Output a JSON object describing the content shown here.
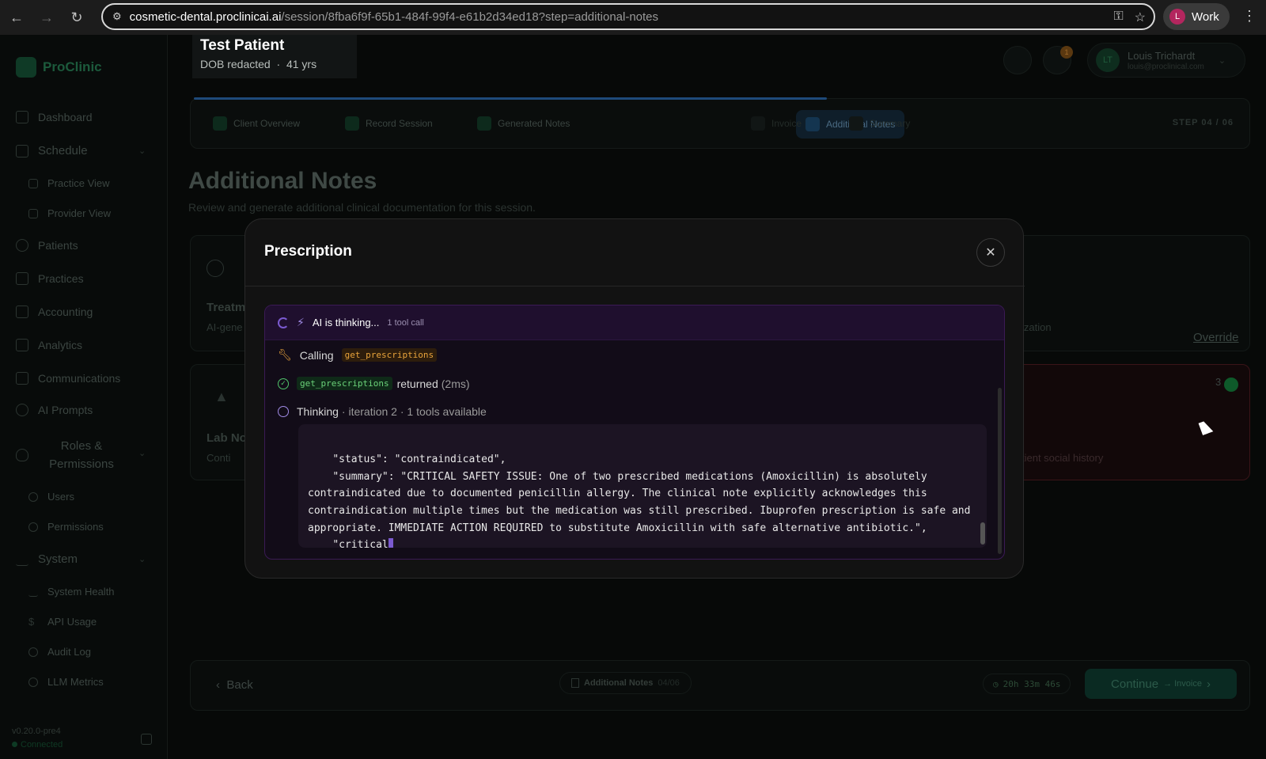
{
  "browser": {
    "url_host": "cosmetic-dental.proclinicai.ai",
    "url_path": "/session/8fba6f9f-65b1-484f-99f4-e61b2d34ed18?step=additional-notes",
    "profile_initial": "L",
    "profile_label": "Work"
  },
  "app": {
    "name": "ProClinic"
  },
  "sidebar": {
    "items": [
      {
        "label": "Dashboard"
      },
      {
        "label": "Schedule"
      },
      {
        "label": "Practice View"
      },
      {
        "label": "Provider View"
      },
      {
        "label": "Patients"
      },
      {
        "label": "Practices"
      },
      {
        "label": "Accounting"
      },
      {
        "label": "Analytics"
      },
      {
        "label": "Communications"
      },
      {
        "label": "AI Prompts"
      },
      {
        "label": "Roles & Permissions"
      },
      {
        "label": "Users"
      },
      {
        "label": "Permissions"
      },
      {
        "label": "System"
      },
      {
        "label": "System Health"
      },
      {
        "label": "API Usage"
      },
      {
        "label": "Audit Log"
      },
      {
        "label": "LLM Metrics"
      }
    ],
    "version": "v0.20.0-pre4",
    "status": "Connected"
  },
  "header": {
    "patient_name": "Test Patient",
    "patient_dob": "DOB redacted",
    "patient_age": "41 yrs",
    "notif_count": "1",
    "user_initials": "LT",
    "user_name": "Louis Trichardt",
    "user_email": "louis@proclinical.com"
  },
  "steps": {
    "items": [
      {
        "label": "Client Overview"
      },
      {
        "label": "Record Session"
      },
      {
        "label": "Generated Notes"
      },
      {
        "label": "Additional Notes"
      },
      {
        "label": "Invoice"
      },
      {
        "label": "Summary"
      }
    ],
    "counter": "STEP 04 / 06"
  },
  "page": {
    "title": "Additional Notes",
    "subtitle": "Review and generate additional clinical documentation for this session.",
    "card1_title": "Treatm",
    "card1_sub": "AI-gene",
    "card1_right": "ization",
    "override": "Override",
    "card2_title": "Lab No",
    "card2_sub": "Conti",
    "card2_right": "tient social history",
    "card2_count": "3"
  },
  "footer": {
    "back": "Back",
    "step_label": "Additional Notes",
    "step_count": "04/06",
    "timer": "20h 33m 46s",
    "continue": "Continue",
    "continue_next": "→ Invoice"
  },
  "modal": {
    "title": "Prescription",
    "thinking_label": "AI is thinking...",
    "tool_count": "1 tool call",
    "calling_label": "Calling",
    "tool_name": "get_prescriptions",
    "returned_tool": "get_prescriptions",
    "returned_label": "returned",
    "returned_time": "(2ms)",
    "thinking_title": "Thinking",
    "thinking_meta": "· iteration 2 · 1 tools available",
    "code_lines": [
      "    \"status\": \"contraindicated\",",
      "    \"summary\": \"CRITICAL SAFETY ISSUE: One of two prescribed medications (Amoxicillin) is absolutely contraindicated due to documented penicillin allergy. The clinical note explicitly acknowledges this contraindication multiple times but the medication was still prescribed. Ibuprofen prescription is safe and appropriate. IMMEDIATE ACTION REQUIRED to substitute Amoxicillin with safe alternative antibiotic.\",",
      "    \"critical"
    ]
  }
}
